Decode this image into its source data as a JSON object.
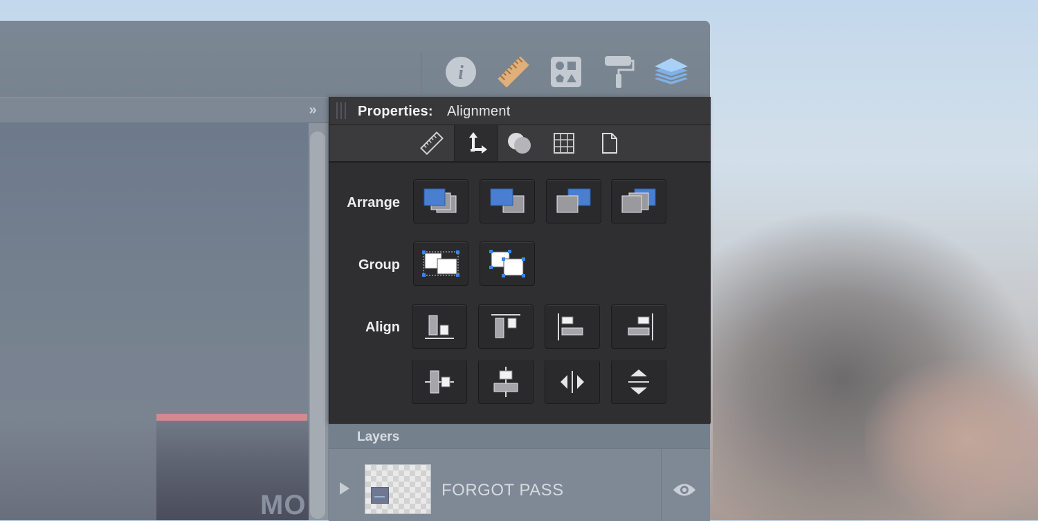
{
  "toolbar": {
    "buttons": [
      {
        "name": "info-icon"
      },
      {
        "name": "ruler-icon"
      },
      {
        "name": "shapes-icon"
      },
      {
        "name": "paint-roller-icon"
      },
      {
        "name": "layers-icon"
      }
    ]
  },
  "canvas": {
    "partial_text": "MO"
  },
  "properties": {
    "title": "Properties:",
    "subtitle": "Alignment",
    "tabs": [
      {
        "name": "ruler-tab-icon"
      },
      {
        "name": "alignment-tab-icon",
        "active": true
      },
      {
        "name": "shapes-overlap-tab-icon"
      },
      {
        "name": "grid-tab-icon"
      },
      {
        "name": "document-tab-icon"
      }
    ],
    "arrange_label": "Arrange",
    "group_label": "Group",
    "align_label": "Align"
  },
  "layers": {
    "title": "Layers",
    "items": [
      {
        "name": "FORGOT PASS",
        "visible": true
      }
    ]
  },
  "colors": {
    "accent_blue": "#4a7fd0",
    "ruler_orange": "#e0b07a",
    "layers_blue": "#8fbef0",
    "panel_dark": "#2f2f31"
  }
}
